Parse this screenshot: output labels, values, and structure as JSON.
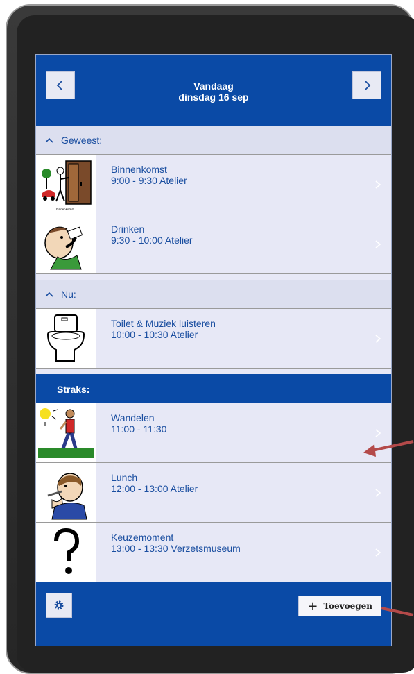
{
  "header": {
    "title_line1": "Vandaag",
    "title_line2": "dinsdag 16 sep"
  },
  "sections": {
    "past": {
      "label": "Geweest:"
    },
    "now": {
      "label": "Nu:"
    },
    "later": {
      "label": "Straks:"
    }
  },
  "items": [
    {
      "title": "Binnenkomst",
      "time": "9:00 - 9:30 Atelier",
      "icon": "entrance-picto-icon",
      "picto_caption": "binnenkomst"
    },
    {
      "title": "Drinken",
      "time": "9:30 - 10:00 Atelier",
      "icon": "drinking-picto-icon"
    },
    {
      "title": "Toilet & Muziek luisteren",
      "time": "10:00 - 10:30 Atelier",
      "icon": "toilet-picto-icon"
    },
    {
      "title": "Wandelen",
      "time": "11:00 - 11:30",
      "icon": "walking-picto-icon"
    },
    {
      "title": "Lunch",
      "time": "12:00 - 13:00 Atelier",
      "icon": "lunch-picto-icon"
    },
    {
      "title": "Keuzemoment",
      "time": "13:00 - 13:30 Verzetsmuseum",
      "icon": "question-picto-icon"
    }
  ],
  "footer": {
    "add_label": "Toevoegen"
  },
  "colors": {
    "brand": "#0a4aa6",
    "row_bg": "#e7e8f6",
    "annotation_arrow": "#b44a4a"
  }
}
